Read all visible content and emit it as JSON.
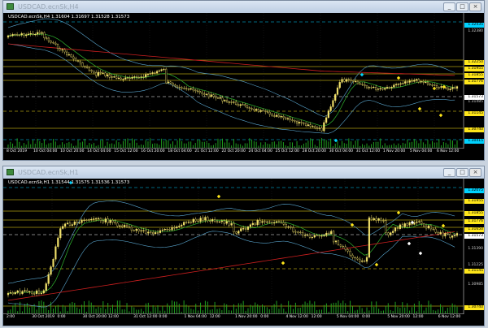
{
  "top": {
    "title": "USDCAD.ecnSk,H4",
    "info": "USDCAD.ecnSk,H4  1.31604 1.31697 1.31528 1.31573",
    "price_labels": [
      {
        "text": "1.32435",
        "style": "c"
      },
      {
        "text": "1.32380",
        "style": "plain"
      },
      {
        "text": "1.32250",
        "style": "y"
      },
      {
        "text": "1.31955",
        "style": "y"
      },
      {
        "text": "1.31855",
        "style": "y"
      },
      {
        "text": "1.31776",
        "style": "y"
      },
      {
        "text": "1.31573",
        "style": "w"
      },
      {
        "text": "1.31485",
        "style": "plain"
      },
      {
        "text": "1.31145",
        "style": "y"
      },
      {
        "text": "1.30740",
        "style": "y"
      },
      {
        "text": "1.30415",
        "style": "c"
      }
    ],
    "time_labels": [
      "8 Oct 2019",
      "10 Oct 04:00",
      "10 Oct 20:00",
      "14 Oct 04:00",
      "15 Oct 12:00",
      "16 Oct 20:00",
      "18 Oct 04:00",
      "21 Oct 12:00",
      "22 Oct 20:00",
      "24 Oct 04:00",
      "25 Oct 12:00",
      "28 Oct 20:00",
      "30 Oct 04:00",
      "31 Oct 12:00",
      "1 Nov 20:00",
      "5 Nov 04:00",
      "6 Nov 12:00"
    ],
    "inner_time_labels": [
      "7:00",
      "7:00",
      "7:00",
      "7:00",
      "7:00",
      "7:00",
      "7:00",
      "7:00",
      "7:00",
      "7:00",
      "7:00"
    ]
  },
  "bottom": {
    "title": "USDCAD.ecnSk,H1",
    "info": "USDCAD.ecnSk,H1  1.31544 1.31575 1.31536 1.31573",
    "price_labels": [
      {
        "text": "1.32075",
        "style": "c"
      },
      {
        "text": "1.31955",
        "style": "y"
      },
      {
        "text": "1.31855",
        "style": "y"
      },
      {
        "text": "1.31776",
        "style": "y"
      },
      {
        "text": "1.31650",
        "style": "y"
      },
      {
        "text": "1.31573",
        "style": "w"
      },
      {
        "text": "1.31390",
        "style": "plain"
      },
      {
        "text": "1.31225",
        "style": "plain"
      },
      {
        "text": "1.31145",
        "style": "y"
      },
      {
        "text": "1.30985",
        "style": "plain"
      },
      {
        "text": "1.30740",
        "style": "y"
      }
    ],
    "time_labels": [
      "2:00",
      "30 Oct 2019",
      "0:00",
      "30 Oct 20:00",
      "12:00",
      "31 Oct 12:00",
      "0:00",
      "1 Nov 04:00",
      "12:00",
      "1 Nov 20:00",
      "0:00",
      "4 Nov 12:00",
      "12:00",
      "5 Nov 04:00",
      "0:00",
      "5 Nov 20:00",
      "12:00",
      "6 Nov 12:00"
    ]
  },
  "controls": {
    "minimize": "_",
    "maximize": "□",
    "close": "×"
  },
  "colors": {
    "yellow": "#ffe61a",
    "cyan": "#00d2ff",
    "red": "#cc1f1f",
    "green": "#2fb52f",
    "band": "#5aa7d0",
    "candle": "#f0e06a",
    "volume": "#1f9e1f"
  }
}
